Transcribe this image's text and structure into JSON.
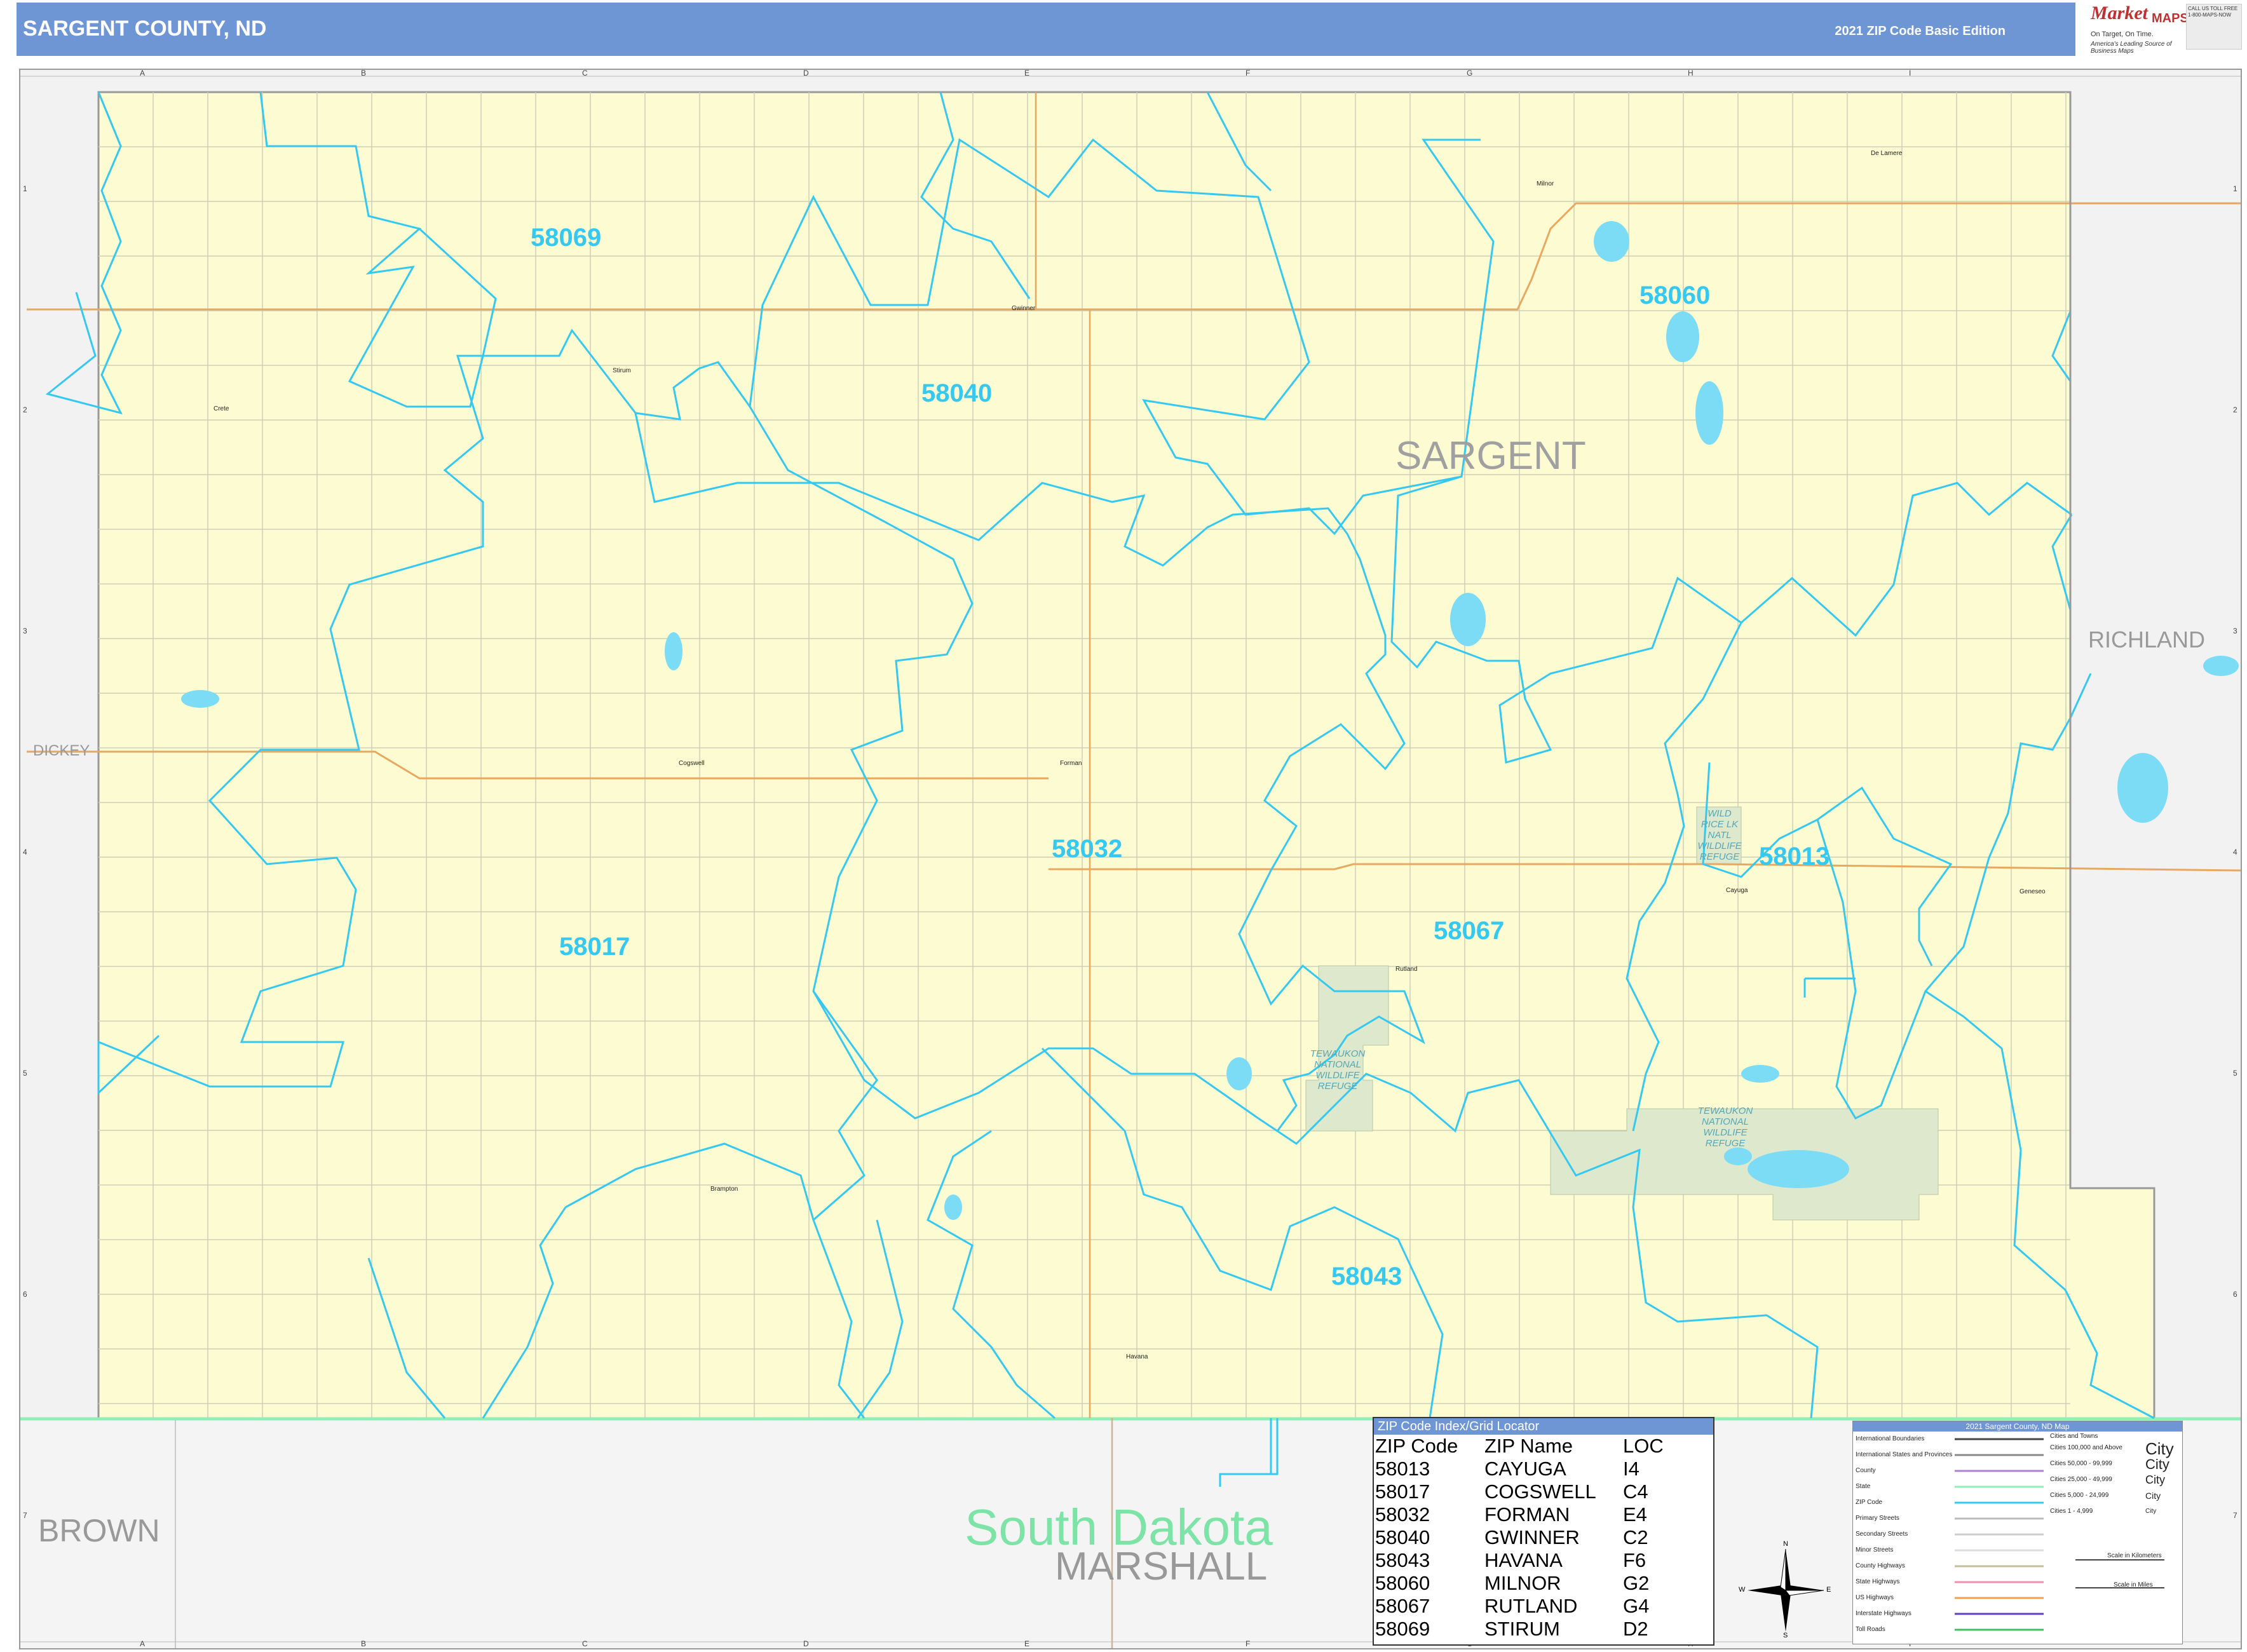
{
  "header": {
    "title": "SARGENT COUNTY, ND",
    "edition": "2021 ZIP Code Basic Edition",
    "accent_color": "#6f96d4"
  },
  "logo": {
    "brand": "Market",
    "maps": "MAPS",
    "tagline": "On Target, On Time.",
    "tagline2": "America's Leading Source of Business Maps",
    "contact": "CALL US TOLL FREE 1-800-MAPS-NOW"
  },
  "grid": {
    "columns": [
      "A",
      "B",
      "C",
      "D",
      "E",
      "F",
      "G",
      "H",
      "I"
    ],
    "rows": [
      "1",
      "2",
      "3",
      "4",
      "5",
      "6",
      "7"
    ]
  },
  "zip_labels": [
    {
      "zip": "58069"
    },
    {
      "zip": "58040"
    },
    {
      "zip": "58060"
    },
    {
      "zip": "58032"
    },
    {
      "zip": "58013"
    },
    {
      "zip": "58017"
    },
    {
      "zip": "58067"
    },
    {
      "zip": "58043"
    }
  ],
  "county_labels": {
    "sargent": "SARGENT",
    "richland": "RICHLAND",
    "dickey": "DICKEY",
    "brown": "BROWN",
    "marshall": "MARSHALL",
    "south_dakota": "South Dakota"
  },
  "towns": [
    "Milnor",
    "De Lamere",
    "Havana",
    "Forman",
    "Cogswell",
    "Cayuga",
    "Rutland",
    "Gwinner",
    "Stirum",
    "Brampton",
    "Geneseo",
    "Crete"
  ],
  "refuges": {
    "wild_rice": "WILD RICE LK NATL WILDLIFE REFUGE",
    "tewaukon_1": "TEWAUKON NATIONAL WILDLIFE REFUGE",
    "tewaukon_2": "TEWAUKON NATIONAL WILDLIFE REFUGE"
  },
  "zip_index": {
    "title": "ZIP Code Index/Grid Locator",
    "headers": {
      "zip": "ZIP Code",
      "name": "ZIP Name",
      "loc": "LOC"
    },
    "rows": [
      {
        "zip": "58013",
        "name": "CAYUGA",
        "loc": "I4"
      },
      {
        "zip": "58017",
        "name": "COGSWELL",
        "loc": "C4"
      },
      {
        "zip": "58032",
        "name": "FORMAN",
        "loc": "E4"
      },
      {
        "zip": "58040",
        "name": "GWINNER",
        "loc": "C2"
      },
      {
        "zip": "58043",
        "name": "HAVANA",
        "loc": "F6"
      },
      {
        "zip": "58060",
        "name": "MILNOR",
        "loc": "G2"
      },
      {
        "zip": "58067",
        "name": "RUTLAND",
        "loc": "G4"
      },
      {
        "zip": "58069",
        "name": "STIRUM",
        "loc": "D2"
      }
    ]
  },
  "legend": {
    "title": "2021 Sargent County, ND Map",
    "items": [
      "International Boundaries",
      "International States and Provinces",
      "County",
      "State",
      "ZIP Code",
      "Primary Streets",
      "Secondary Streets",
      "Minor Streets",
      "County Highways",
      "State Highways",
      "US Highways",
      "Interstate Highways",
      "Toll Roads"
    ],
    "cities_title": "Cities and Towns",
    "cities": [
      "Cities 100,000 and Above",
      "Cities 50,000 - 99,999",
      "Cities 25,000 - 49,999",
      "Cities 5,000 - 24,999",
      "Cities 1 - 4,999"
    ],
    "city_sample": "City",
    "scale_km": "Scale in Kilometers",
    "scale_mi": "Scale in Miles"
  },
  "compass": {
    "n": "N",
    "s": "S",
    "e": "E",
    "w": "W"
  },
  "colors": {
    "county_fill": "#fdfbd2",
    "zip_boundary": "#35c8f0",
    "state_line": "#8ef0b8",
    "highway": "#e8a860",
    "refuge_fill": "#dde8cc",
    "water": "#7ddcf5"
  }
}
